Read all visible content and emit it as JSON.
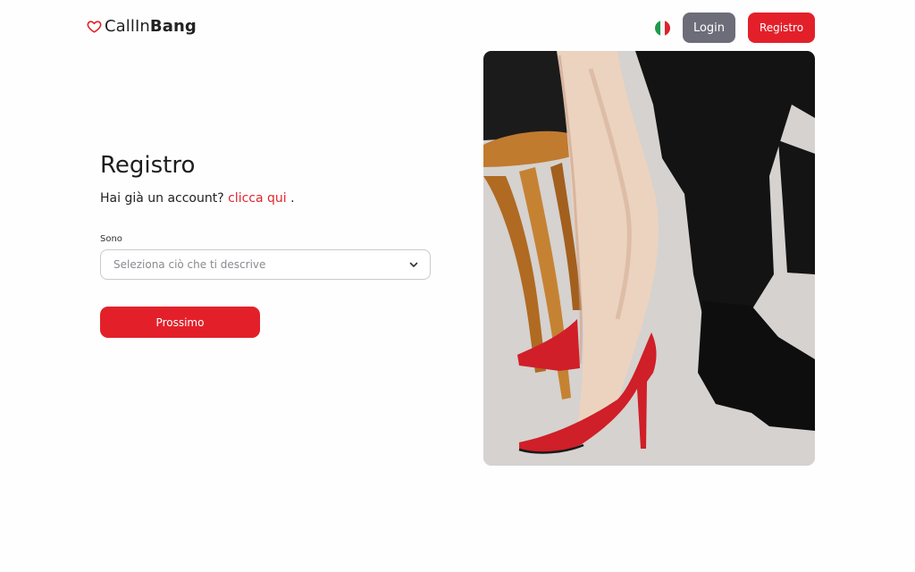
{
  "header": {
    "logo_light": "CallIn",
    "logo_bold": "Bang",
    "language_flag": "italy-flag",
    "login_label": "Login",
    "register_label": "Registro"
  },
  "form": {
    "title": "Registro",
    "account_prompt": "Hai già un account?",
    "account_link": "clicca qui",
    "account_suffix": " .",
    "field_label": "Sono",
    "select_placeholder": "Seleziona ciò che ti descrive",
    "next_label": "Prossimo"
  },
  "colors": {
    "accent": "#e3202a",
    "login_button": "#6c6d78",
    "link": "#e0262e"
  },
  "icons": {
    "logo": "heart-icon",
    "select": "chevron-down-icon"
  }
}
